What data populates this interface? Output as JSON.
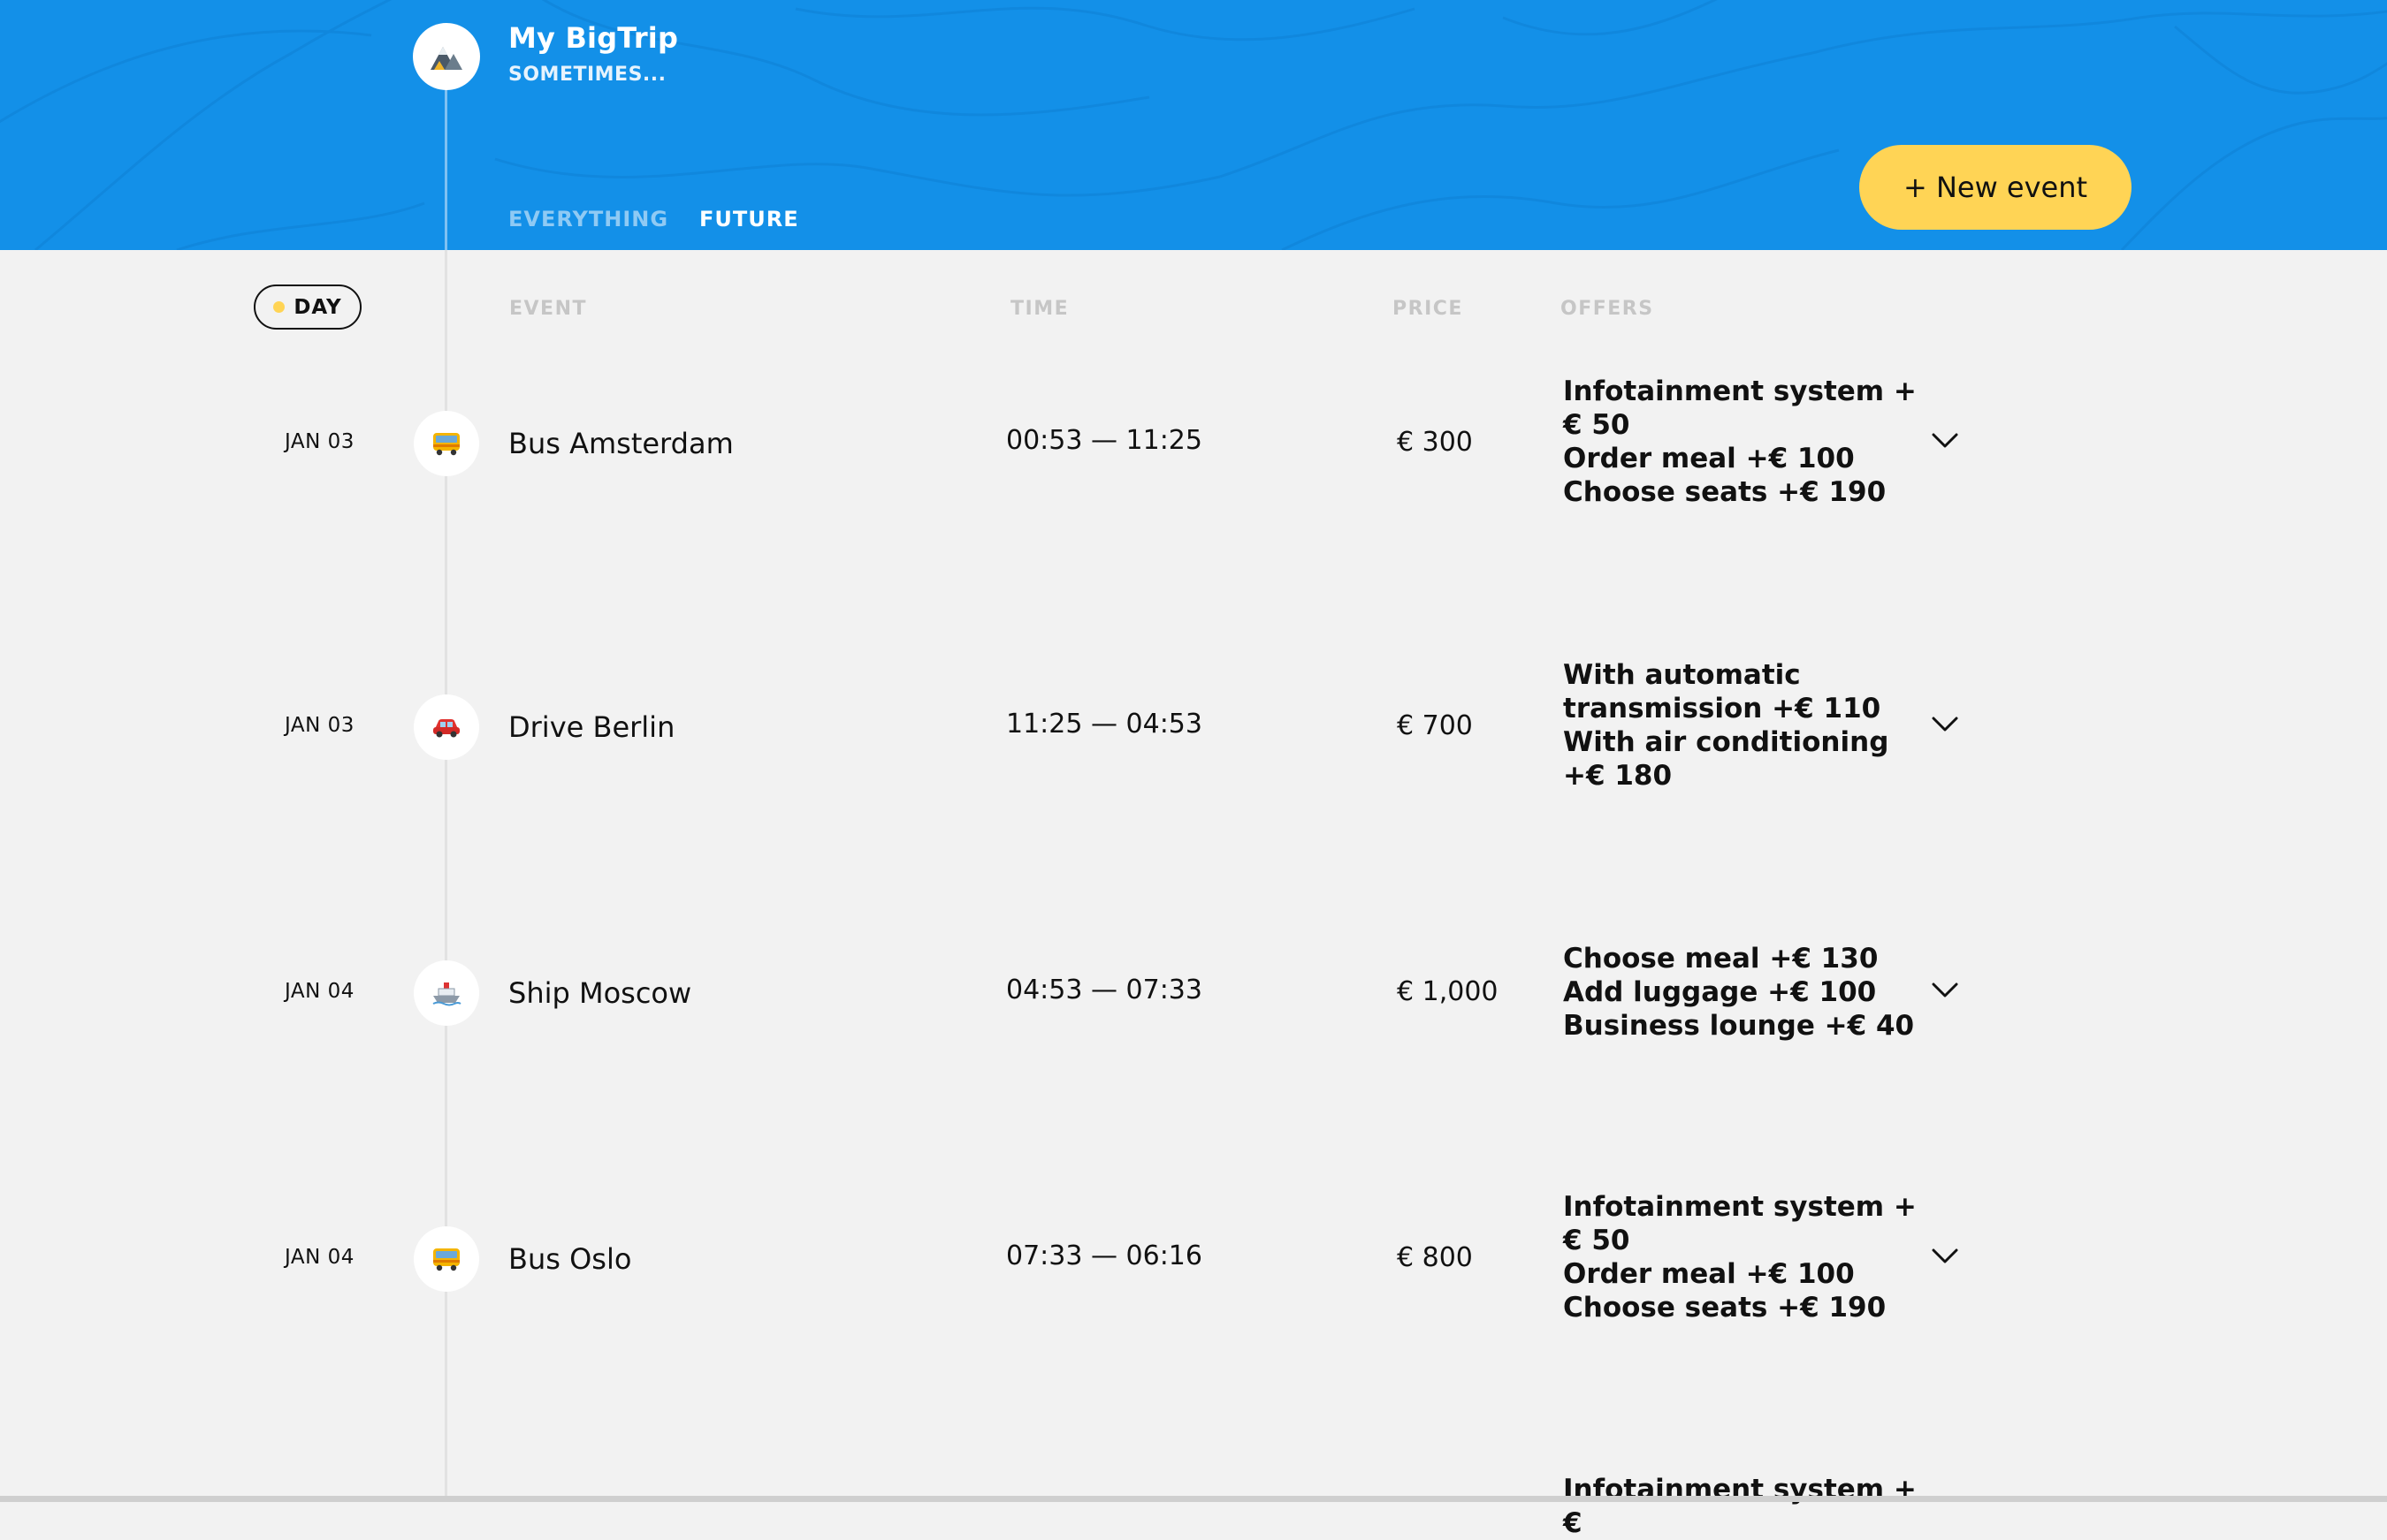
{
  "header": {
    "title": "My BigTrip",
    "dates": "SOMETIMES...",
    "logo_icon": "mountain-logo-icon",
    "background_color": "#1390e8",
    "filters": [
      {
        "label": "EVERYTHING",
        "active": false
      },
      {
        "label": "FUTURE",
        "active": true
      }
    ],
    "new_event_label": "+ New event",
    "new_event_color": "#ffd455"
  },
  "table": {
    "day_label": "DAY",
    "columns": {
      "event": "EVENT",
      "time": "TIME",
      "price": "PRICE",
      "offers": "OFFERS"
    }
  },
  "events": [
    {
      "date": "JAN 03",
      "icon": "bus-icon",
      "name": "Bus Amsterdam",
      "time": "00:53 — 11:25",
      "price": "€ 300",
      "offers": [
        "Infotainment system +€ 50",
        "Order meal +€  100",
        "Choose seats +€  190"
      ]
    },
    {
      "date": "JAN 03",
      "icon": "car-icon",
      "name": "Drive Berlin",
      "time": "11:25 — 04:53",
      "price": "€ 700",
      "offers": [
        "With automatic transmission +€  110",
        "With air conditioning +€  180"
      ]
    },
    {
      "date": "JAN 04",
      "icon": "ship-icon",
      "name": "Ship Moscow",
      "time": "04:53 — 07:33",
      "price": "€ 1,000",
      "offers": [
        "Choose meal +€  130",
        "Add luggage +€  100",
        "Business lounge +€  40"
      ]
    },
    {
      "date": "JAN 04",
      "icon": "bus-icon",
      "name": "Bus Oslo",
      "time": "07:33 — 06:16",
      "price": "€ 800",
      "offers": [
        "Infotainment system +€ 50",
        "Order meal +€  100",
        "Choose seats +€  190"
      ]
    },
    {
      "date": "",
      "icon": "",
      "name": "",
      "time": "",
      "price": "",
      "offers": [
        "Infotainment system +€"
      ]
    }
  ]
}
